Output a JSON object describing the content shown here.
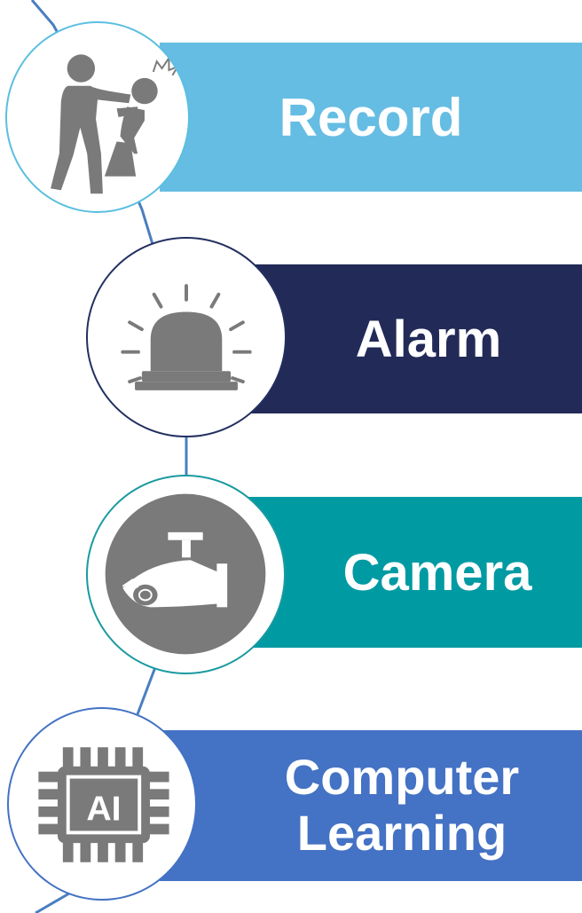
{
  "colors": {
    "record": "#66bde3",
    "alarm": "#222a58",
    "camera": "#009aa3",
    "computer_learning": "#4472c4",
    "icon_gray": "#7a7a7a",
    "connector": "#4a7fc0"
  },
  "items": [
    {
      "label": "Record",
      "icon": "assault-figures-icon"
    },
    {
      "label": "Alarm",
      "icon": "siren-icon"
    },
    {
      "label": "Camera",
      "icon": "security-camera-icon"
    },
    {
      "label_line1": "Computer",
      "label_line2": "Learning",
      "icon": "ai-chip-icon"
    }
  ],
  "chip_text": "AI"
}
